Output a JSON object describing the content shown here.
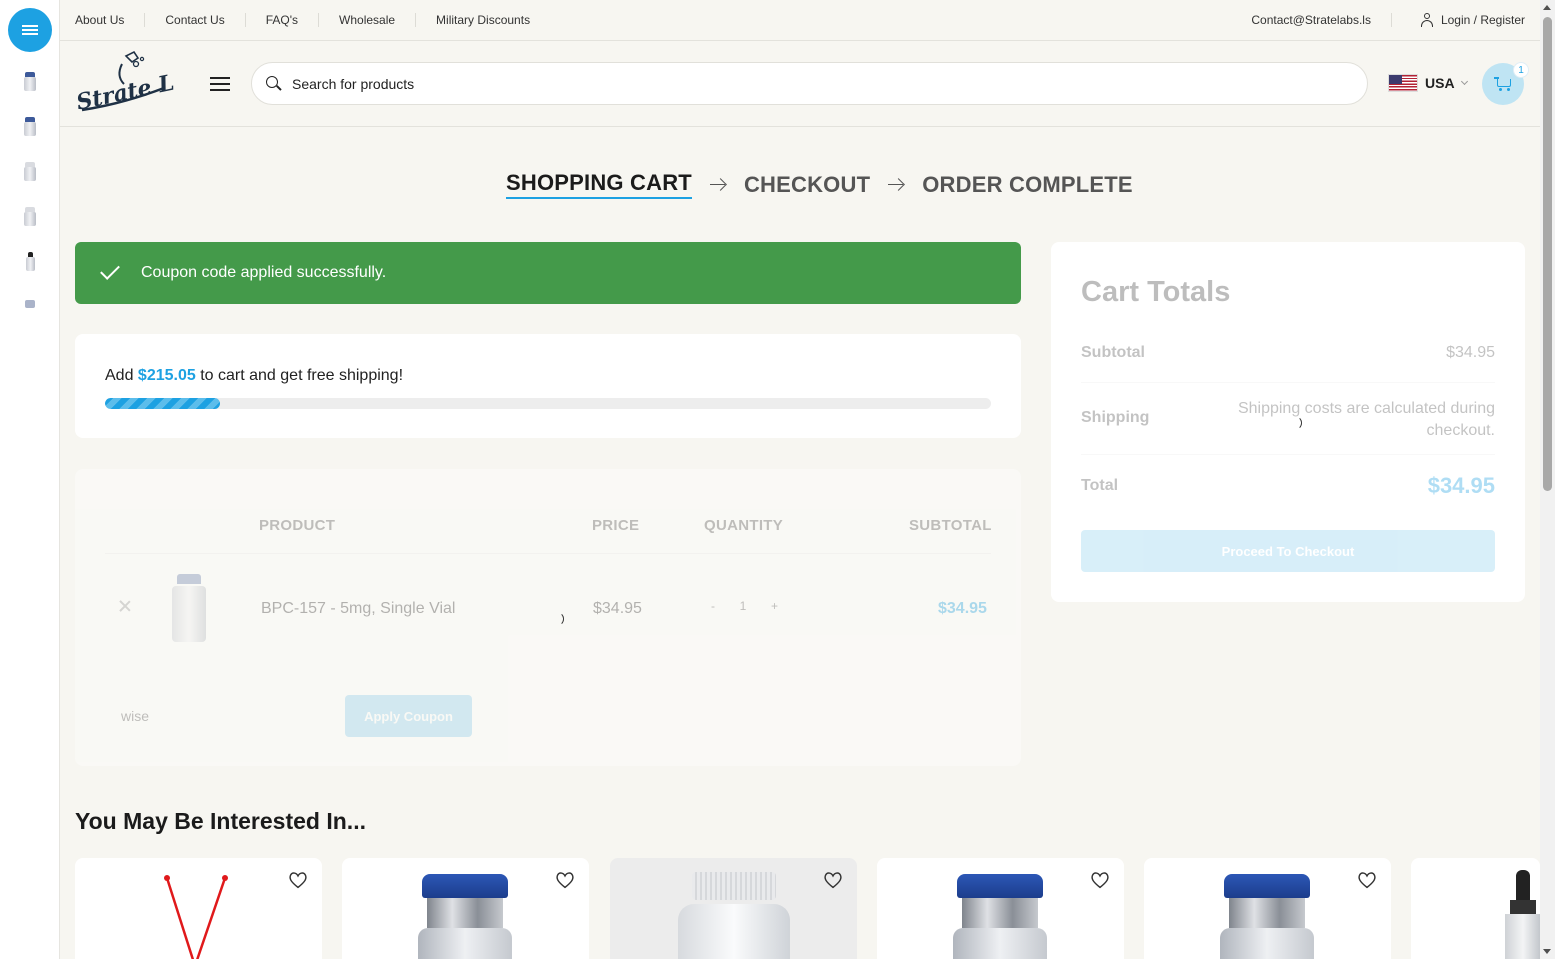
{
  "topbar": {
    "links": [
      "About Us",
      "Contact Us",
      "FAQ's",
      "Wholesale",
      "Military Discounts"
    ],
    "email": "Contact@Stratelabs.ls",
    "login": "Login / Register"
  },
  "header": {
    "logo_text": "Strate Labs",
    "search_placeholder": "Search for products",
    "country": "USA",
    "cart_count": "1"
  },
  "steps": [
    "SHOPPING CART",
    "CHECKOUT",
    "ORDER COMPLETE"
  ],
  "notice": "Coupon code applied successfully.",
  "shipping": {
    "prefix": "Add",
    "amount": "$215.05",
    "suffix": "to cart and get free shipping!",
    "progress_percent": 13
  },
  "cart": {
    "headers": [
      "PRODUCT",
      "PRICE",
      "QUANTITY",
      "SUBTOTAL"
    ],
    "items": [
      {
        "name": "BPC-157 - 5mg, Single Vial",
        "price": "$34.95",
        "quantity": "1",
        "subtotal": "$34.95"
      }
    ],
    "qty_minus": "-",
    "qty_plus": "+",
    "coupon_value": "wise",
    "coupon_button": "Apply Coupon"
  },
  "totals": {
    "title": "Cart Totals",
    "subtotal_label": "Subtotal",
    "subtotal_value": "$34.95",
    "shipping_label": "Shipping",
    "shipping_value": "Shipping costs are calculated during checkout.",
    "total_label": "Total",
    "total_value": "$34.95",
    "checkout_button": "Proceed To Checkout"
  },
  "related": {
    "title": "You May Be Interested In..."
  },
  "colors": {
    "accent": "#1da1e2",
    "success": "#449a4a",
    "background": "#f7f6f1"
  }
}
